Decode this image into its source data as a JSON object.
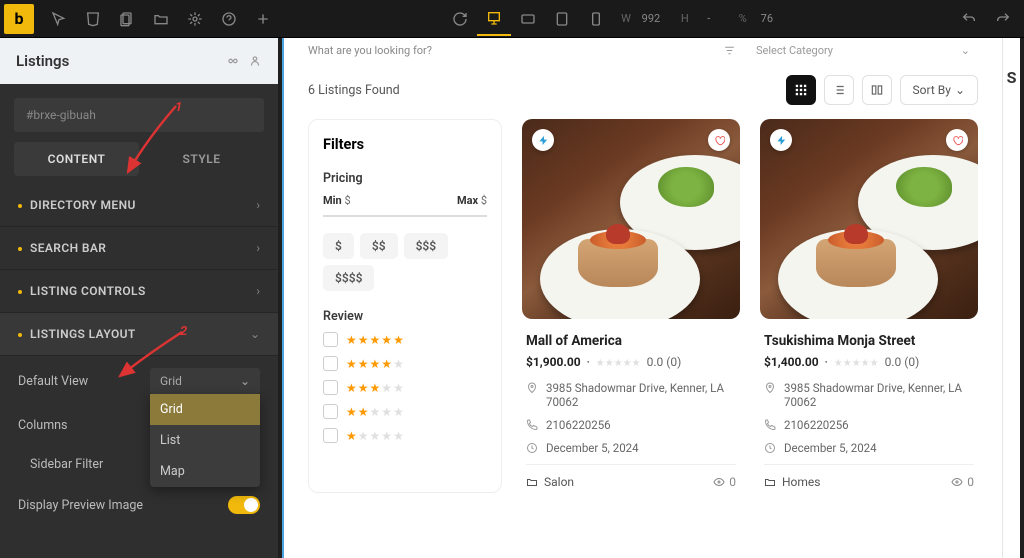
{
  "toolbar": {
    "logo": "b",
    "dims": {
      "w_label": "W",
      "w_val": "992",
      "h_label": "H",
      "h_val": "-",
      "pct_label": "%",
      "pct_val": "76"
    }
  },
  "panel": {
    "title": "Listings",
    "element_id": "#brxe-gibuah",
    "tabs": {
      "content": "CONTENT",
      "style": "STYLE"
    },
    "sections": {
      "directory": "DIRECTORY MENU",
      "search": "SEARCH BAR",
      "controls": "LISTING CONTROLS",
      "layout": "LISTINGS LAYOUT"
    },
    "controls": {
      "default_view": "Default View",
      "default_view_val": "Grid",
      "columns": "Columns",
      "sidebar_filter": "Sidebar Filter",
      "display_preview": "Display Preview Image"
    },
    "dropdown": {
      "grid": "Grid",
      "list": "List",
      "map": "Map"
    }
  },
  "annotations": {
    "num1": "1",
    "num2": "2"
  },
  "preview": {
    "search_placeholder": "What are you looking for?",
    "category_placeholder": "Select Category",
    "found": "6 Listings Found",
    "sort": "Sort By",
    "filters": {
      "title": "Filters",
      "pricing": "Pricing",
      "min": "Min",
      "max": "Max",
      "dollar": "$",
      "review": "Review",
      "pills": [
        "$",
        "$$",
        "$$$",
        "$$$$"
      ]
    },
    "cards": [
      {
        "title": "Mall of America",
        "price": "$1,900.00",
        "rating": "0.0 (0)",
        "address": "3985 Shadowmar Drive, Kenner, LA 70062",
        "phone": "2106220256",
        "date": "December 5, 2024",
        "category": "Salon",
        "views": "0"
      },
      {
        "title": "Tsukishima Monja Street",
        "price": "$1,400.00",
        "rating": "0.0 (0)",
        "address": "3985 Shadowmar Drive, Kenner, LA 70062",
        "phone": "2106220256",
        "date": "December 5, 2024",
        "category": "Homes",
        "views": "0"
      }
    ]
  },
  "right": {
    "char": "S"
  }
}
